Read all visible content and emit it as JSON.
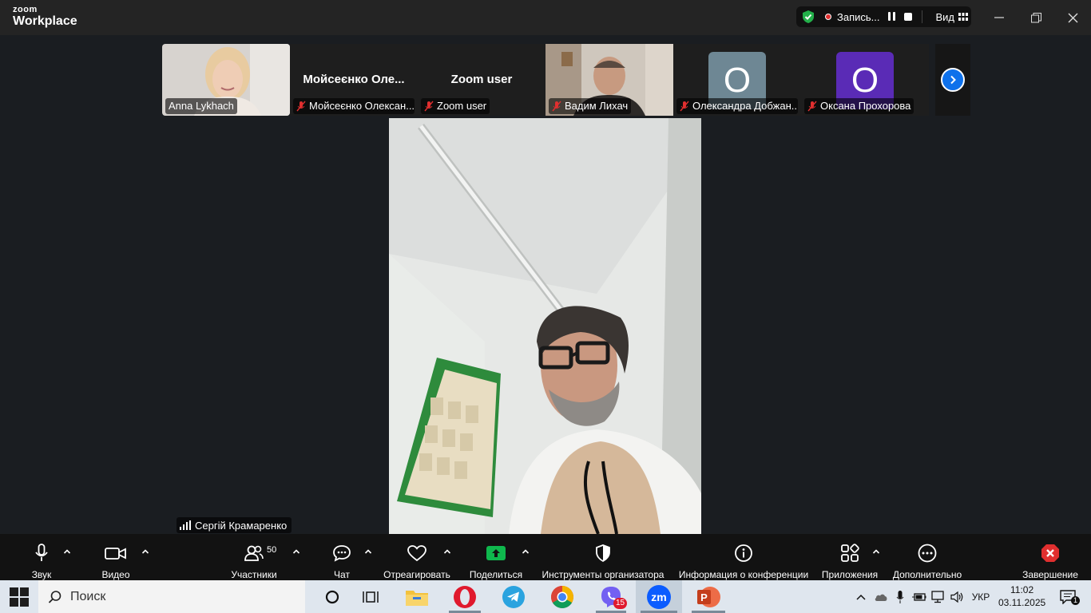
{
  "titlebar": {
    "logo_line1": "zoom",
    "logo_line2": "Workplace",
    "recording_label": "Запись...",
    "view_label": "Вид"
  },
  "gallery": [
    {
      "display": "video",
      "label": "Anna Lykhach",
      "muted": false
    },
    {
      "display": "name",
      "big_name": "Мойсеєнко  Оле...",
      "label": "Мойсеєнко Олексан...",
      "muted": true
    },
    {
      "display": "name",
      "big_name": "Zoom user",
      "label": "Zoom user",
      "muted": true
    },
    {
      "display": "video",
      "label": "Вадим Лихач",
      "muted": true
    },
    {
      "display": "avatar",
      "initial": "О",
      "avatar_color": "#6e8794",
      "label": "Олександра Добжан...",
      "muted": true
    },
    {
      "display": "avatar",
      "initial": "О",
      "avatar_color": "#5a2bb6",
      "label": "Оксана Прохорова",
      "muted": true
    }
  ],
  "speaker": {
    "name": "Сергій Крамаренко"
  },
  "toolbar": {
    "audio": "Звук",
    "video": "Видео",
    "participants": "Участники",
    "participants_count": "50",
    "chat": "Чат",
    "react": "Отреагировать",
    "share": "Поделиться",
    "host_tools": "Инструменты организатора",
    "meeting_info": "Информация о конференции",
    "apps": "Приложения",
    "more": "Дополнительно",
    "end": "Завершение"
  },
  "taskbar": {
    "search_placeholder": "Поиск",
    "viber_badge": "15",
    "lang": "УКР",
    "time": "11:02",
    "date": "03.11.2025",
    "notif_count": "1"
  },
  "colors": {
    "accent_blue": "#0e71eb",
    "share_green": "#0fb84d",
    "end_red": "#e02f2f",
    "shield_green": "#23b04a"
  }
}
